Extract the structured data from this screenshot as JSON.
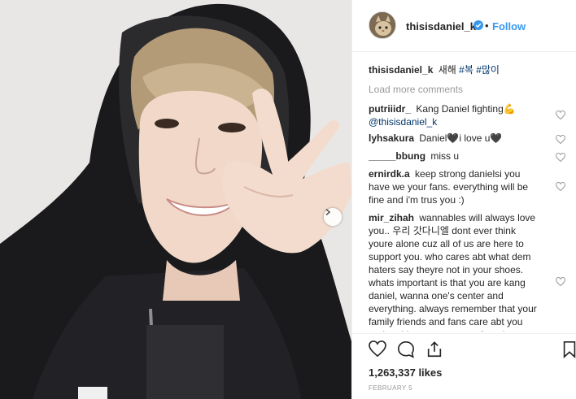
{
  "post": {
    "username": "thisisdaniel_k",
    "follow_label": "Follow",
    "separator": "•",
    "verified": true,
    "accent_color": "#3897f0"
  },
  "caption": {
    "username": "thisisdaniel_k",
    "text": "새해",
    "hashtags": [
      "#복",
      "#많이"
    ]
  },
  "load_more_label": "Load more comments",
  "comments": [
    {
      "user": "putriiidr_",
      "text": "Kang Daniel fighting💪",
      "mention": "@thisisdaniel_k"
    },
    {
      "user": "lyhsakura",
      "text": "Daniel🖤i love u🖤"
    },
    {
      "user": "_____bbung",
      "text": "miss u"
    },
    {
      "user": "ernirdk.a",
      "text": "keep strong danielsi you have we your fans. everything will be fine and i'm trus you :)"
    },
    {
      "user": "mir_zihah",
      "text": "wannables will always love you.. 우리 갓다니엘 dont ever think youre alone cuz all of us are here to support you. who cares abt what dem haters say theyre not in your shoes. whats important is that you are kang daniel, wanna one's center and everything. always remember that your family friends and fans care abt you and nothing can stop you from it"
    }
  ],
  "likes": "1,263,337 likes",
  "date": "FEBRUARY 5"
}
